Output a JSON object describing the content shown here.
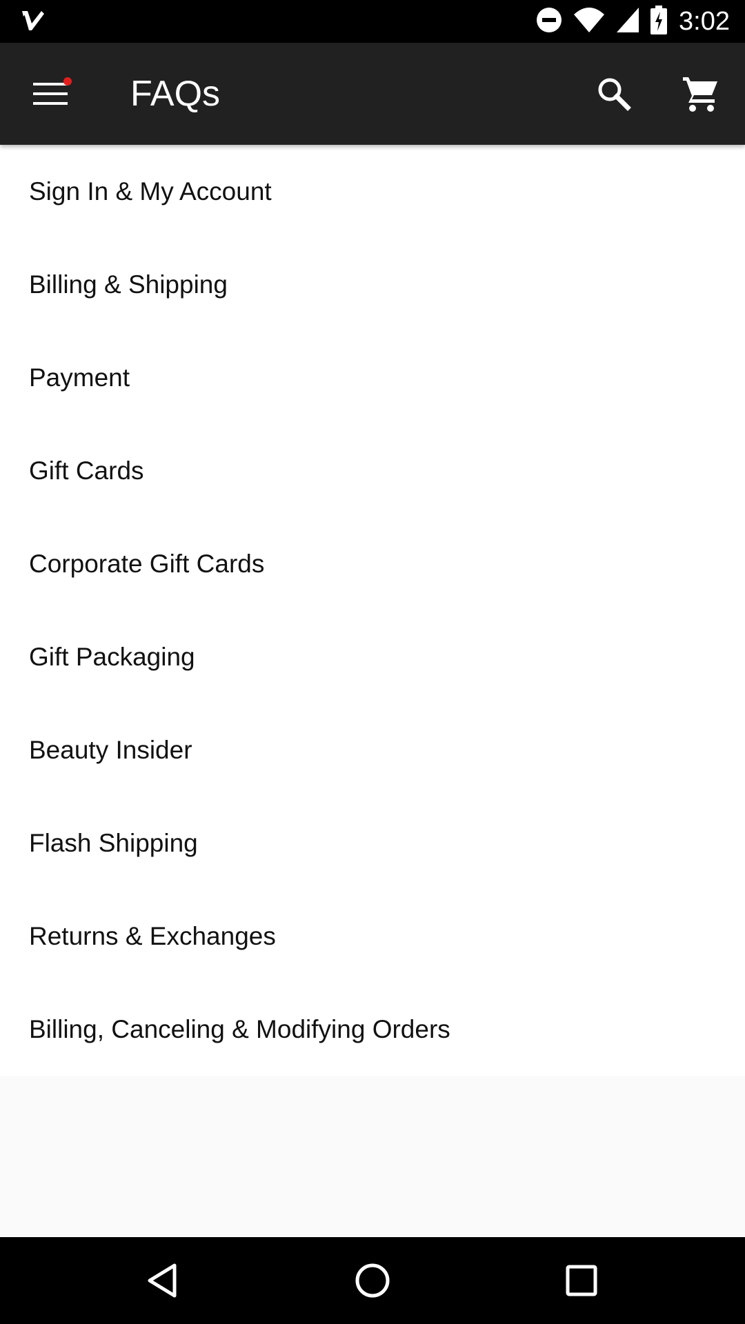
{
  "status_bar": {
    "time": "3:02",
    "icons": [
      "app-notification-icon",
      "do-not-disturb-icon",
      "wifi-icon",
      "signal-icon",
      "battery-charging-icon"
    ]
  },
  "app_bar": {
    "title": "FAQs",
    "menu_icon": "menu-icon",
    "notification_dot_color": "#e21f1f",
    "search_icon": "search-icon",
    "cart_icon": "shopping-cart-icon",
    "background": "#212121"
  },
  "faq_list": {
    "items": [
      {
        "label": "Sign In & My Account"
      },
      {
        "label": "Billing & Shipping"
      },
      {
        "label": "Payment"
      },
      {
        "label": "Gift Cards"
      },
      {
        "label": "Corporate Gift Cards"
      },
      {
        "label": "Gift Packaging"
      },
      {
        "label": "Beauty Insider"
      },
      {
        "label": "Flash Shipping"
      },
      {
        "label": "Returns & Exchanges"
      },
      {
        "label": "Billing, Canceling & Modifying Orders"
      }
    ]
  },
  "nav_bar": {
    "icons": [
      "back-icon",
      "home-icon",
      "recent-apps-icon"
    ]
  }
}
